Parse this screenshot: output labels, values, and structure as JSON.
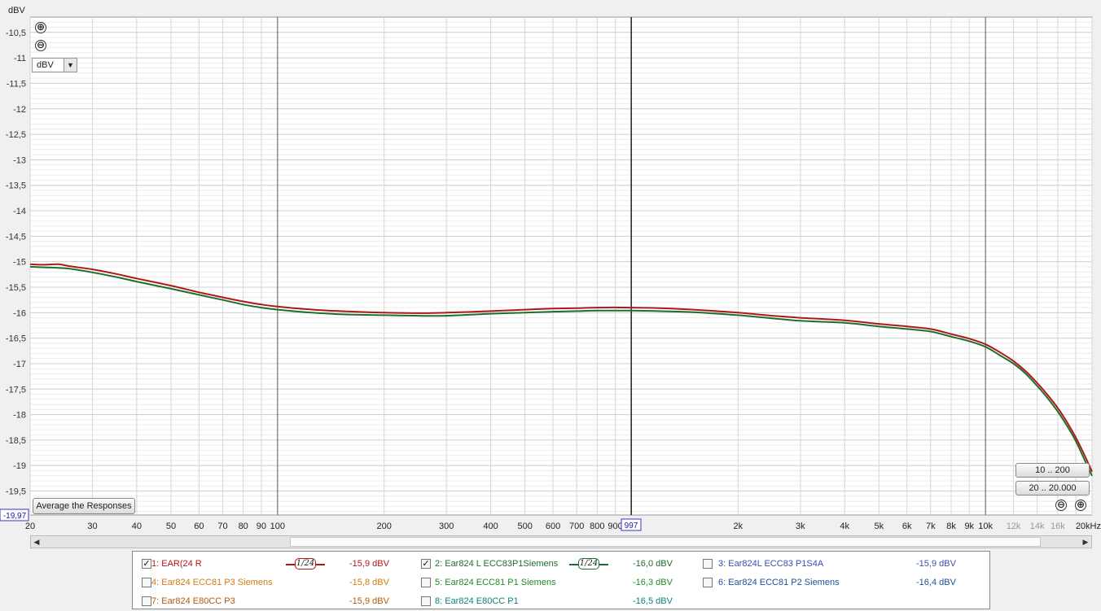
{
  "chart_data": {
    "type": "line",
    "ylabel": "dBV",
    "xunit": "Hz",
    "xscale": "log",
    "xlim": [
      20,
      20000
    ],
    "ylim": [
      -19.97,
      -10.2
    ],
    "grid": true,
    "y_ticks": [
      "-10,5",
      "-11",
      "-11,5",
      "-12",
      "-12,5",
      "-13",
      "-13,5",
      "-14",
      "-14,5",
      "-15",
      "-15,5",
      "-16",
      "-16,5",
      "-17",
      "-17,5",
      "-18",
      "-18,5",
      "-19",
      "-19,5"
    ],
    "y_tick_values": [
      -10.5,
      -11,
      -11.5,
      -12,
      -12.5,
      -13,
      -13.5,
      -14,
      -14.5,
      -15,
      -15.5,
      -16,
      -16.5,
      -17,
      -17.5,
      -18,
      -18.5,
      -19,
      -19.5
    ],
    "x_ticks": [
      {
        "value": 20,
        "label": "20"
      },
      {
        "value": 30,
        "label": "30"
      },
      {
        "value": 40,
        "label": "40"
      },
      {
        "value": 50,
        "label": "50"
      },
      {
        "value": 60,
        "label": "60"
      },
      {
        "value": 70,
        "label": "70"
      },
      {
        "value": 80,
        "label": "80"
      },
      {
        "value": 90,
        "label": "90"
      },
      {
        "value": 100,
        "label": "100"
      },
      {
        "value": 200,
        "label": "200"
      },
      {
        "value": 300,
        "label": "300"
      },
      {
        "value": 400,
        "label": "400"
      },
      {
        "value": 500,
        "label": "500"
      },
      {
        "value": 600,
        "label": "600"
      },
      {
        "value": 700,
        "label": "700"
      },
      {
        "value": 800,
        "label": "800"
      },
      {
        "value": 900,
        "label": "900"
      },
      {
        "value": 2000,
        "label": "2k"
      },
      {
        "value": 3000,
        "label": "3k"
      },
      {
        "value": 4000,
        "label": "4k"
      },
      {
        "value": 5000,
        "label": "5k"
      },
      {
        "value": 6000,
        "label": "6k"
      },
      {
        "value": 7000,
        "label": "7k"
      },
      {
        "value": 8000,
        "label": "8k"
      },
      {
        "value": 9000,
        "label": "9k"
      },
      {
        "value": 10000,
        "label": "10k"
      },
      {
        "value": 12000,
        "label": "12k"
      },
      {
        "value": 14000,
        "label": "14k"
      },
      {
        "value": 16000,
        "label": "16k"
      },
      {
        "value": 20000,
        "label": "20kHz"
      }
    ],
    "cursor": {
      "x": 997,
      "x_label": "997",
      "y_label": "-19,97"
    },
    "series": [
      {
        "name": "1: EAR(24 R",
        "color": "#b01818",
        "points": [
          [
            20,
            -15.05
          ],
          [
            22,
            -15.06
          ],
          [
            24,
            -15.05
          ],
          [
            26,
            -15.09
          ],
          [
            30,
            -15.15
          ],
          [
            35,
            -15.24
          ],
          [
            40,
            -15.33
          ],
          [
            50,
            -15.47
          ],
          [
            60,
            -15.6
          ],
          [
            70,
            -15.7
          ],
          [
            80,
            -15.78
          ],
          [
            90,
            -15.84
          ],
          [
            100,
            -15.88
          ],
          [
            120,
            -15.93
          ],
          [
            150,
            -15.97
          ],
          [
            200,
            -16.0
          ],
          [
            250,
            -16.01
          ],
          [
            300,
            -16.0
          ],
          [
            400,
            -15.97
          ],
          [
            500,
            -15.94
          ],
          [
            600,
            -15.92
          ],
          [
            700,
            -15.91
          ],
          [
            800,
            -15.9
          ],
          [
            997,
            -15.9
          ],
          [
            1200,
            -15.91
          ],
          [
            1500,
            -15.94
          ],
          [
            2000,
            -16.0
          ],
          [
            2500,
            -16.06
          ],
          [
            3000,
            -16.1
          ],
          [
            4000,
            -16.15
          ],
          [
            5000,
            -16.22
          ],
          [
            6000,
            -16.27
          ],
          [
            7000,
            -16.32
          ],
          [
            8000,
            -16.42
          ],
          [
            9000,
            -16.51
          ],
          [
            10000,
            -16.62
          ],
          [
            11000,
            -16.78
          ],
          [
            12000,
            -16.95
          ],
          [
            13000,
            -17.15
          ],
          [
            14000,
            -17.38
          ],
          [
            15000,
            -17.62
          ],
          [
            16000,
            -17.87
          ],
          [
            17000,
            -18.15
          ],
          [
            18000,
            -18.45
          ],
          [
            19000,
            -18.78
          ],
          [
            20000,
            -19.12
          ]
        ]
      },
      {
        "name": "2: Ear824 L ECC83P1Siemens",
        "color": "#1e6e2e",
        "points": [
          [
            20,
            -15.1
          ],
          [
            22,
            -15.11
          ],
          [
            24,
            -15.12
          ],
          [
            26,
            -15.14
          ],
          [
            30,
            -15.21
          ],
          [
            35,
            -15.3
          ],
          [
            40,
            -15.39
          ],
          [
            50,
            -15.53
          ],
          [
            60,
            -15.65
          ],
          [
            70,
            -15.75
          ],
          [
            80,
            -15.84
          ],
          [
            90,
            -15.9
          ],
          [
            100,
            -15.94
          ],
          [
            120,
            -15.99
          ],
          [
            150,
            -16.03
          ],
          [
            200,
            -16.05
          ],
          [
            250,
            -16.06
          ],
          [
            300,
            -16.06
          ],
          [
            400,
            -16.02
          ],
          [
            500,
            -16.0
          ],
          [
            600,
            -15.98
          ],
          [
            700,
            -15.97
          ],
          [
            800,
            -15.96
          ],
          [
            997,
            -15.96
          ],
          [
            1200,
            -15.97
          ],
          [
            1500,
            -15.99
          ],
          [
            2000,
            -16.05
          ],
          [
            2500,
            -16.11
          ],
          [
            3000,
            -16.16
          ],
          [
            4000,
            -16.2
          ],
          [
            5000,
            -16.27
          ],
          [
            6000,
            -16.32
          ],
          [
            7000,
            -16.37
          ],
          [
            8000,
            -16.47
          ],
          [
            9000,
            -16.56
          ],
          [
            10000,
            -16.67
          ],
          [
            11000,
            -16.84
          ],
          [
            12000,
            -17.0
          ],
          [
            13000,
            -17.2
          ],
          [
            14000,
            -17.44
          ],
          [
            15000,
            -17.68
          ],
          [
            16000,
            -17.94
          ],
          [
            17000,
            -18.22
          ],
          [
            18000,
            -18.52
          ],
          [
            19000,
            -18.87
          ],
          [
            20000,
            -19.2
          ]
        ]
      }
    ]
  },
  "controls": {
    "unit_select": "dBV",
    "average_button": "Average the Responses",
    "range_btn_1": "10 .. 200",
    "range_btn_2": "20 .. 20.000",
    "zoom_in": "⊕",
    "zoom_out": "⊖"
  },
  "legend": {
    "items": [
      {
        "label": "1: EAR(24 R",
        "value": "-15,9 dBV",
        "checked": true,
        "color": "#b01818",
        "smoothing": "1/24"
      },
      {
        "label": "2: Ear824 L ECC83P1Siemens",
        "value": "-16,0 dBV",
        "checked": true,
        "color": "#1e6e2e",
        "smoothing": "1/24"
      },
      {
        "label": "3: Ear824L ECC83 P1S4A",
        "value": "-15,9 dBV",
        "checked": false,
        "color": "#3a4fb0"
      },
      {
        "label": "4: Ear824 ECC81 P3 Siemens",
        "value": "-15,8 dBV",
        "checked": false,
        "color": "#d27a10"
      },
      {
        "label": "5: Ear824 ECC81 P1 Siemens",
        "value": "-16,3 dBV",
        "checked": false,
        "color": "#1f8a2a"
      },
      {
        "label": "6: Ear824 ECC81 P2 Siemens",
        "value": "-16,4 dBV",
        "checked": false,
        "color": "#1c4f9a"
      },
      {
        "label": "7: Ear824 E80CC P3",
        "value": "-15,9 dBV",
        "checked": false,
        "color": "#b05a10"
      },
      {
        "label": "8: Ear824 E80CC P1",
        "value": "-16,5 dBV",
        "checked": false,
        "color": "#0f7f7a"
      }
    ]
  }
}
